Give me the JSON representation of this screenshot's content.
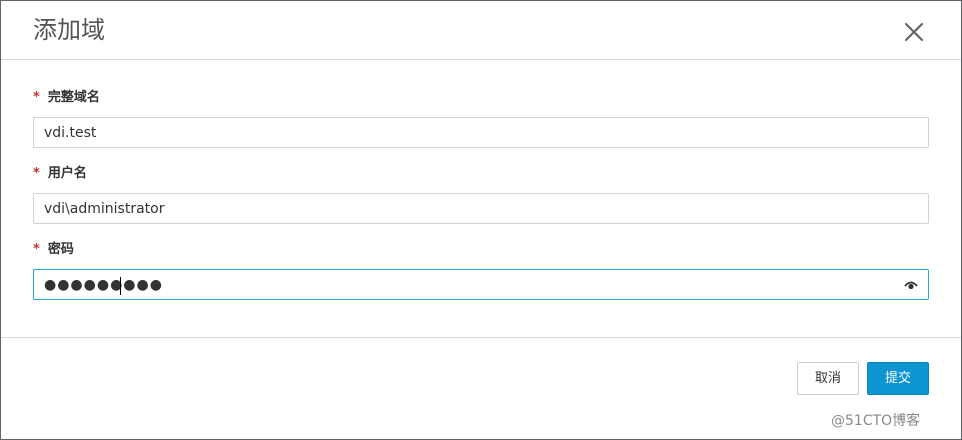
{
  "dialog": {
    "title": "添加域",
    "close_icon": "close-icon"
  },
  "fields": {
    "domain": {
      "required_mark": "*",
      "label": "完整域名",
      "value": "vdi.test"
    },
    "username": {
      "required_mark": "*",
      "label": "用户名",
      "value": "vdi\\administrator"
    },
    "password": {
      "required_mark": "*",
      "label": "密码",
      "masked_value": "●●●●●●●●●",
      "visibility_icon": "eye-icon"
    }
  },
  "buttons": {
    "cancel": "取消",
    "submit": "提交"
  },
  "colors": {
    "accent": "#0c95d1",
    "required": "#c9302c",
    "focus_border": "#2aa6d0"
  },
  "watermark": "@51CTO博客"
}
